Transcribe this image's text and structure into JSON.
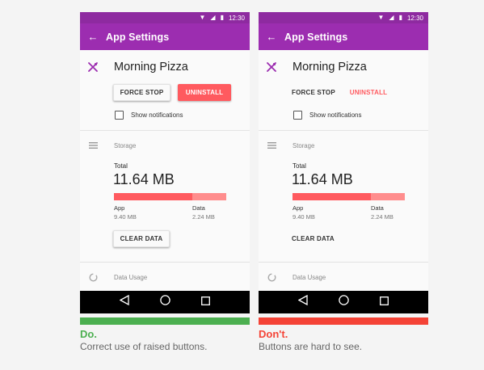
{
  "colors": {
    "primary": "#9c2db0",
    "primary_dark": "#8e2aa0",
    "accent_red": "#ff5a5f",
    "do_green": "#4caf50",
    "dont_red": "#f44336"
  },
  "statusbar": {
    "time": "12:30",
    "icons": [
      "wifi-icon",
      "signal-icon",
      "battery-icon"
    ]
  },
  "appbar": {
    "title": "App Settings",
    "back_icon": "arrow-back-icon"
  },
  "app": {
    "name": "Morning Pizza",
    "icon": "fork-knife-icon"
  },
  "buttons": {
    "force_stop": "FORCE STOP",
    "uninstall": "UNINSTALL",
    "clear_data": "CLEAR DATA"
  },
  "notifications": {
    "label": "Show notifications",
    "checked": false
  },
  "storage": {
    "section_label": "Storage",
    "total_label": "Total",
    "total_value": "11.64 MB",
    "app_label": "App",
    "app_value": "9.40 MB",
    "data_label": "Data",
    "data_value": "2.24 MB",
    "app_fraction": 0.7
  },
  "data_usage": {
    "section_label": "Data Usage"
  },
  "navbar": {
    "icons": [
      "back-triangle-icon",
      "home-circle-icon",
      "recents-square-icon"
    ]
  },
  "examples": {
    "do": {
      "title": "Do.",
      "description": "Correct use of raised buttons."
    },
    "dont": {
      "title": "Don't.",
      "description": "Buttons are hard to see."
    }
  }
}
